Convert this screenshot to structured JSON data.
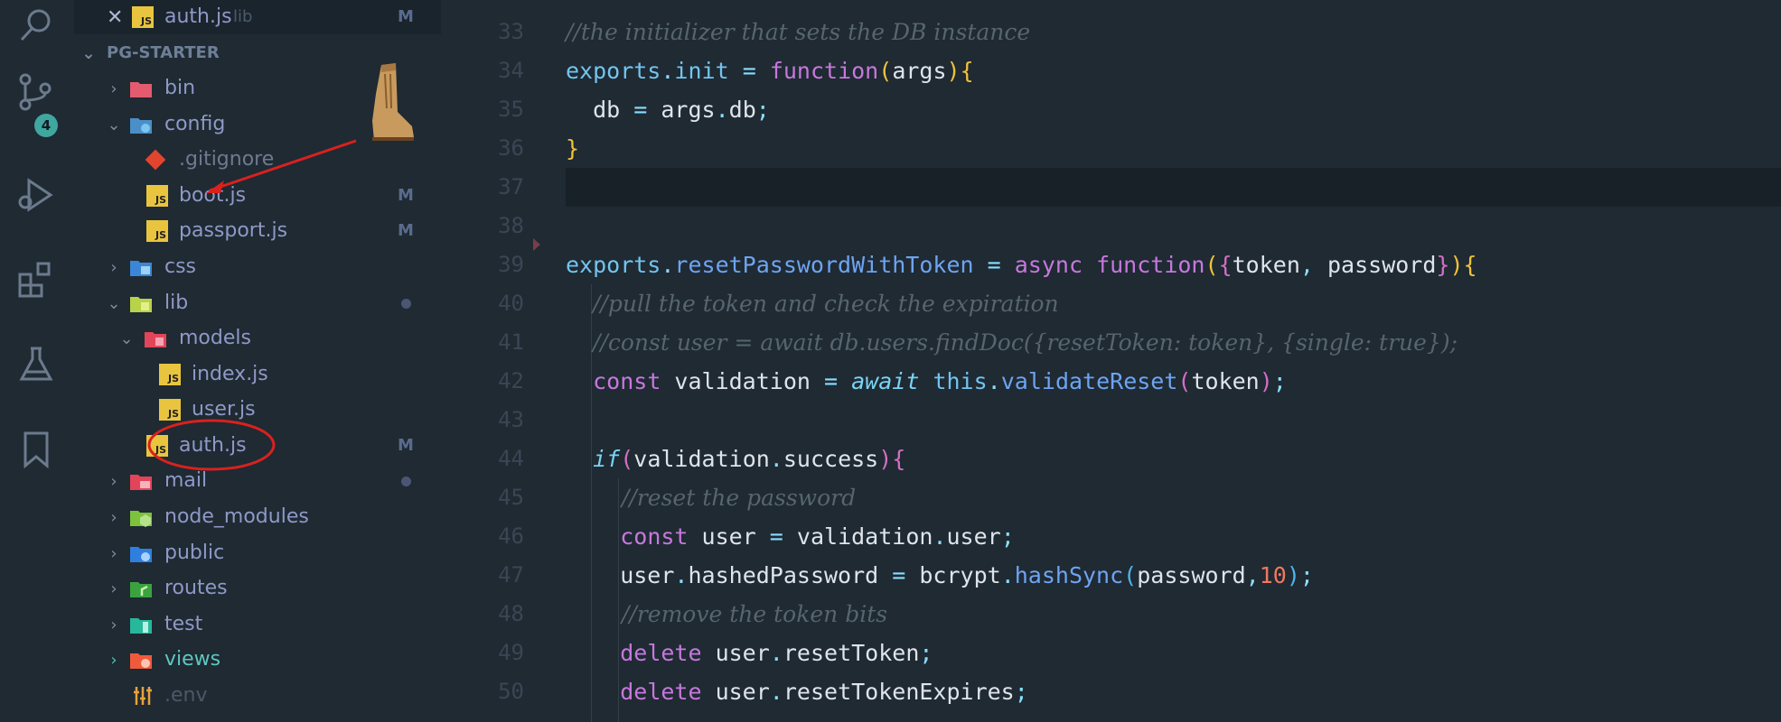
{
  "activity_bar": {
    "scm_badge": "4",
    "icons": [
      "search-icon",
      "source-control-icon",
      "run-debug-icon",
      "extensions-icon",
      "testing-icon",
      "bookmarks-icon"
    ]
  },
  "open_editor": {
    "name": "auth.js",
    "path": "lib",
    "status": "M"
  },
  "explorer": {
    "folder_title": "PG-STARTER",
    "items": [
      {
        "label": "bin"
      },
      {
        "label": "config"
      },
      {
        "label": ".gitignore"
      },
      {
        "label": "boot.js",
        "status": "M"
      },
      {
        "label": "passport.js",
        "status": "M"
      },
      {
        "label": "css"
      },
      {
        "label": "lib"
      },
      {
        "label": "models"
      },
      {
        "label": "index.js"
      },
      {
        "label": "user.js"
      },
      {
        "label": "auth.js",
        "status": "M"
      },
      {
        "label": "mail"
      },
      {
        "label": "node_modules"
      },
      {
        "label": "public"
      },
      {
        "label": "routes"
      },
      {
        "label": "test"
      },
      {
        "label": "views"
      },
      {
        "label": ".env"
      }
    ]
  },
  "editor": {
    "line_numbers": [
      "33",
      "34",
      "35",
      "36",
      "37",
      "38",
      "39",
      "40",
      "41",
      "42",
      "43",
      "44",
      "45",
      "46",
      "47",
      "48",
      "49",
      "50"
    ],
    "comments": {
      "l33": "//the initializer that sets the DB instance",
      "l40": "//pull the token and check the expiration",
      "l41": "//const user = await db.users.findDoc({resetToken: token}, {single: true});",
      "l45": "//reset the password",
      "l48": "//remove the token bits"
    },
    "colors": {
      "background": "#1f2a33",
      "keyword": "#c678dd",
      "function": "#6ea4f2",
      "comment": "#56656f",
      "number": "#f07860"
    }
  }
}
